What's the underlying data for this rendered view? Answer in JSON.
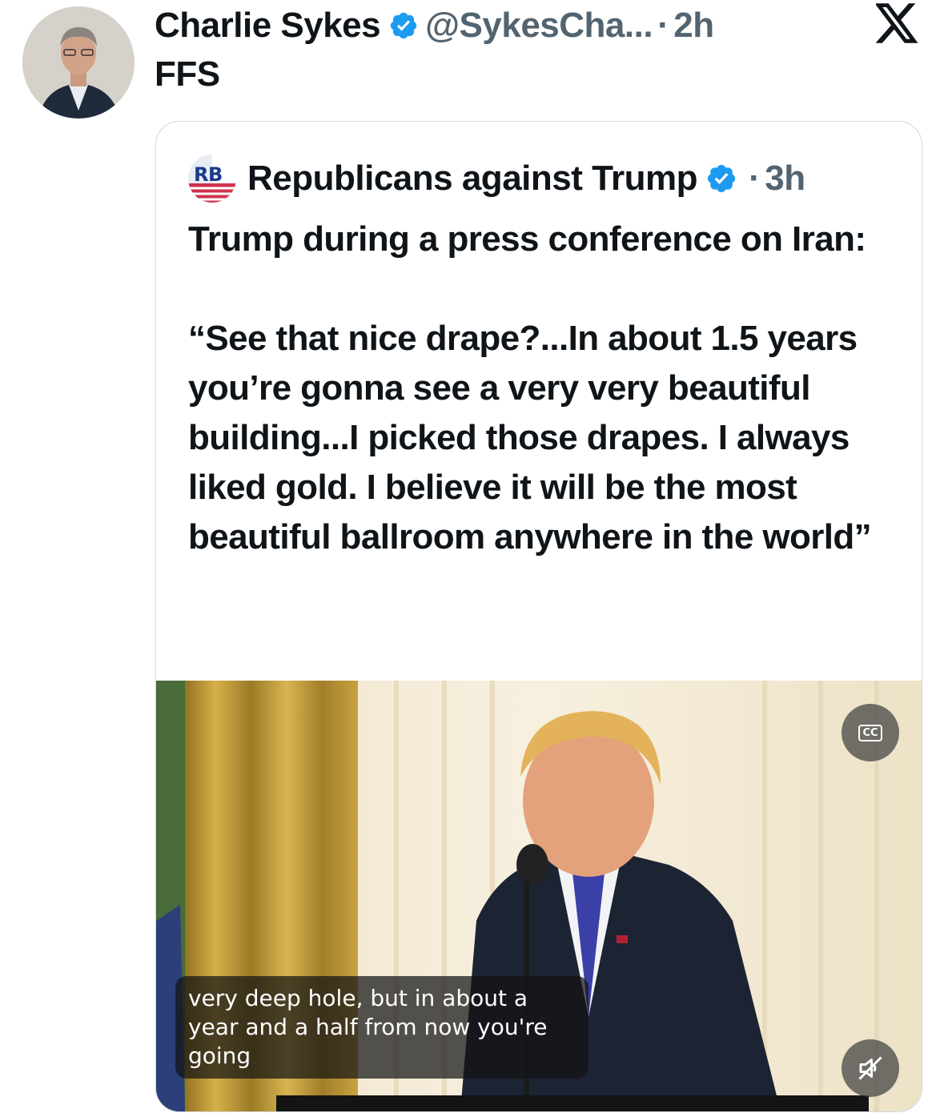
{
  "tweet": {
    "author_name": "Charlie Sykes",
    "handle": "@SykesCha...",
    "separator": "·",
    "time": "2h",
    "text": "FFS"
  },
  "quoted_tweet": {
    "author_name": "Republicans against Trump",
    "avatar_text": "RB",
    "separator": "·",
    "time": "3h",
    "lines": [
      "Trump during a press conference on Iran:",
      "",
      "“See that nice drape?...In about 1.5 years you’re gonna see a very very beautiful building...I picked those drapes. I always liked gold. I believe it will be the most beautiful ballroom anywhere in the world”"
    ],
    "video": {
      "cc_label": "CC",
      "caption": "very deep hole, but in about a year and a half from now you're going"
    }
  },
  "icons": {
    "verified": "verified-badge-icon",
    "brand": "x-logo-icon",
    "closed_captions": "cc-icon",
    "mute": "speaker-muted-icon"
  },
  "colors": {
    "verified_blue": "#1d9bf0",
    "secondary_text": "#536471",
    "card_border": "#cfd9de"
  }
}
